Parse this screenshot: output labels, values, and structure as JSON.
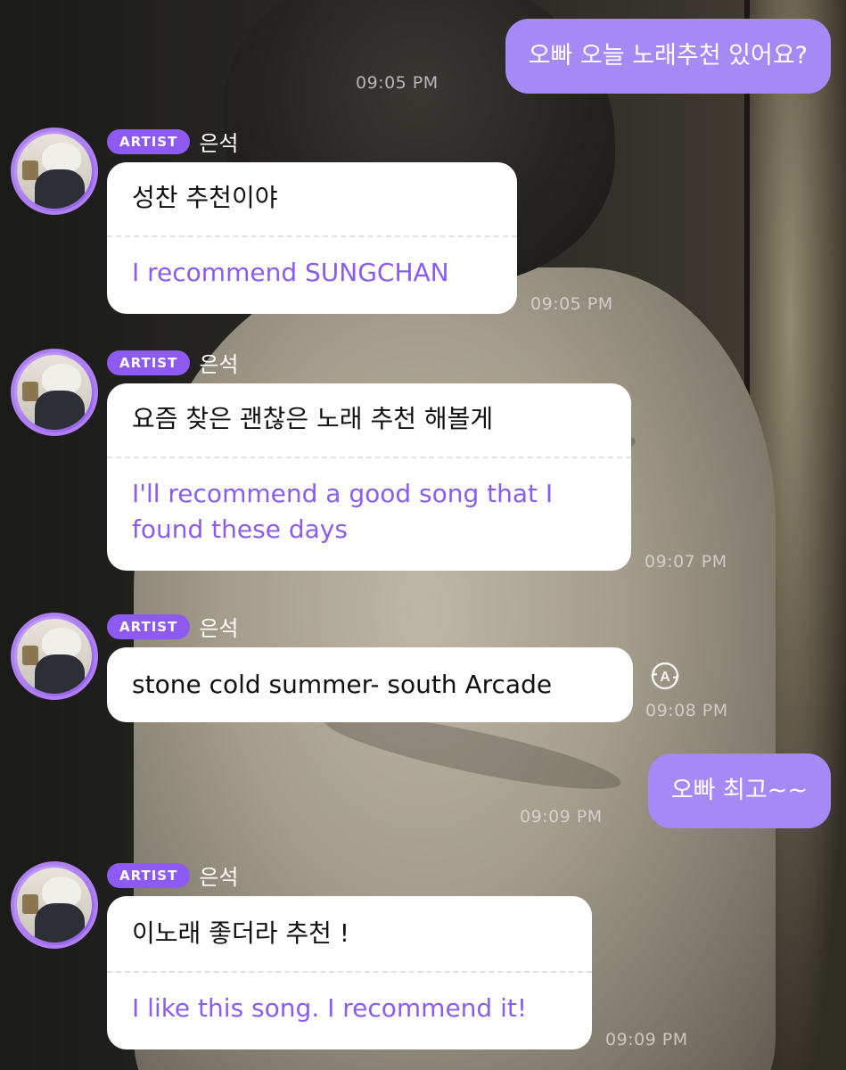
{
  "messages": {
    "m1": {
      "text": "오빠 오늘 노래추천 있어요?",
      "time": "09:05 PM"
    },
    "m2": {
      "badge": "ARTIST",
      "name": "은석",
      "ko": "성찬 추천이야",
      "en": "I recommend SUNGCHAN",
      "time": "09:05 PM"
    },
    "m3": {
      "badge": "ARTIST",
      "name": "은석",
      "ko": "요즘 찾은 괜찮은 노래 추천 해볼게",
      "en_line1": "I'll recommend a good song that I",
      "en_line2": "found these days",
      "time": "09:07 PM"
    },
    "m4": {
      "badge": "ARTIST",
      "name": "은석",
      "text": "stone cold summer- south Arcade",
      "time": "09:08 PM"
    },
    "m5": {
      "text": "오빠 최고~~",
      "time": "09:09 PM"
    },
    "m6": {
      "badge": "ARTIST",
      "name": "은석",
      "ko": "이노래 좋더라 추천 !",
      "en": "I like this song. I recommend it!",
      "time": "09:09 PM"
    }
  },
  "colors": {
    "my_bubble": "#a58af5",
    "badge": "#8d5af4",
    "translation_text": "#8a5cf0"
  },
  "icons": {
    "translate": "translate-icon",
    "avatar": "avatar-image"
  }
}
